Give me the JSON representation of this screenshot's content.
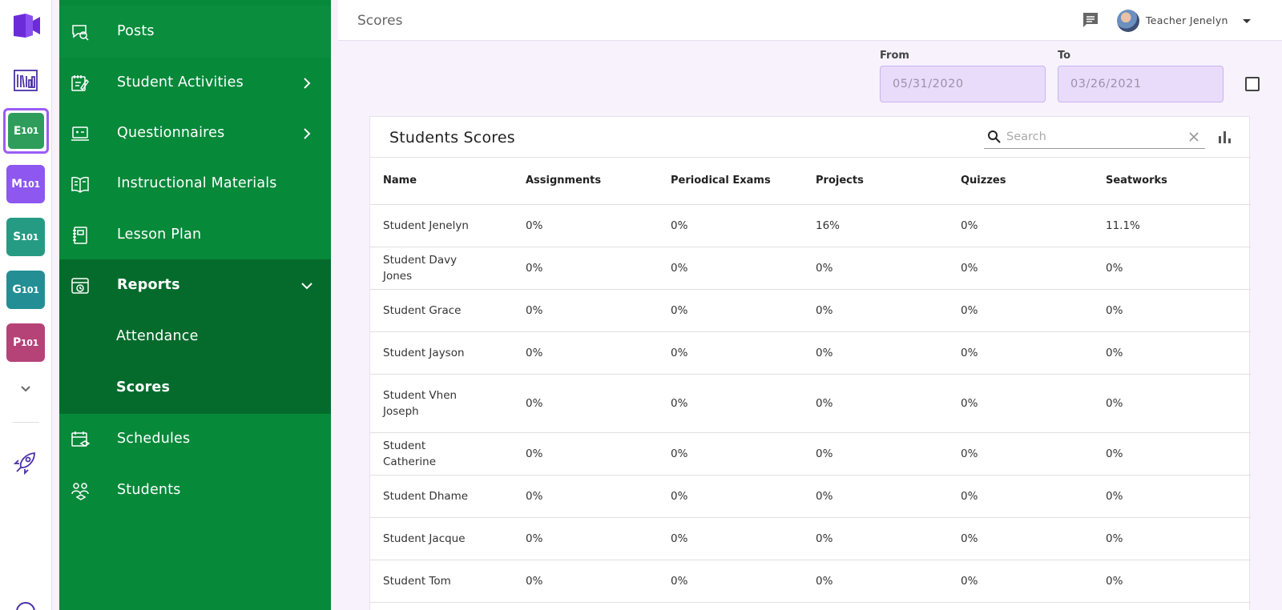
{
  "header": {
    "title": "Scores",
    "user_name": "Teacher Jenelyn"
  },
  "rail": {
    "classes": [
      {
        "letter": "E",
        "number": "101",
        "color": "#2e9d5b",
        "active": true
      },
      {
        "letter": "M",
        "number": "101",
        "color": "#8d57f0"
      },
      {
        "letter": "S",
        "number": "101",
        "color": "#269b83"
      },
      {
        "letter": "G",
        "number": "101",
        "color": "#238f94"
      },
      {
        "letter": "P",
        "number": "101",
        "color": "#b54377"
      }
    ]
  },
  "sidebar": {
    "items": [
      {
        "label": "Posts",
        "icon": "posts-icon"
      },
      {
        "label": "Student Activities",
        "icon": "activities-icon",
        "has_chevron": true
      },
      {
        "label": "Questionnaires",
        "icon": "questionnaire-icon",
        "has_chevron": true
      },
      {
        "label": "Instructional Materials",
        "icon": "book-icon"
      },
      {
        "label": "Lesson Plan",
        "icon": "notebook-icon"
      },
      {
        "label": "Reports",
        "icon": "reports-icon",
        "expanded": true
      },
      {
        "label": "Schedules",
        "icon": "calendar-icon"
      },
      {
        "label": "Students",
        "icon": "students-icon"
      }
    ],
    "reports_sub": [
      {
        "label": "Attendance"
      },
      {
        "label": "Scores",
        "selected": true
      }
    ]
  },
  "filters": {
    "from_label": "From",
    "from_value": "05/31/2020",
    "to_label": "To",
    "to_value": "03/26/2021"
  },
  "card": {
    "title": "Students Scores",
    "search_placeholder": "Search",
    "columns": [
      "Name",
      "Assignments",
      "Periodical Exams",
      "Projects",
      "Quizzes",
      "Seatworks"
    ],
    "rows": [
      [
        "Student Jenelyn",
        "0%",
        "0%",
        "16%",
        "0%",
        "11.1%"
      ],
      [
        "Student Davy Jones",
        "0%",
        "0%",
        "0%",
        "0%",
        "0%"
      ],
      [
        "Student Grace",
        "0%",
        "0%",
        "0%",
        "0%",
        "0%"
      ],
      [
        "Student Jayson",
        "0%",
        "0%",
        "0%",
        "0%",
        "0%"
      ],
      [
        "Student Vhen Joseph",
        "0%",
        "0%",
        "0%",
        "0%",
        "0%"
      ],
      [
        "Student Catherine",
        "0%",
        "0%",
        "0%",
        "0%",
        "0%"
      ],
      [
        "Student Dhame",
        "0%",
        "0%",
        "0%",
        "0%",
        "0%"
      ],
      [
        "Student Jacque",
        "0%",
        "0%",
        "0%",
        "0%",
        "0%"
      ],
      [
        "Student Tom",
        "0%",
        "0%",
        "0%",
        "0%",
        "0%"
      ]
    ]
  },
  "colors": {
    "sidebar_green": "#07893a",
    "sidebar_active": "#056b2c",
    "accent_purple": "#6c2bd9",
    "date_bg": "#e9dcfb"
  }
}
